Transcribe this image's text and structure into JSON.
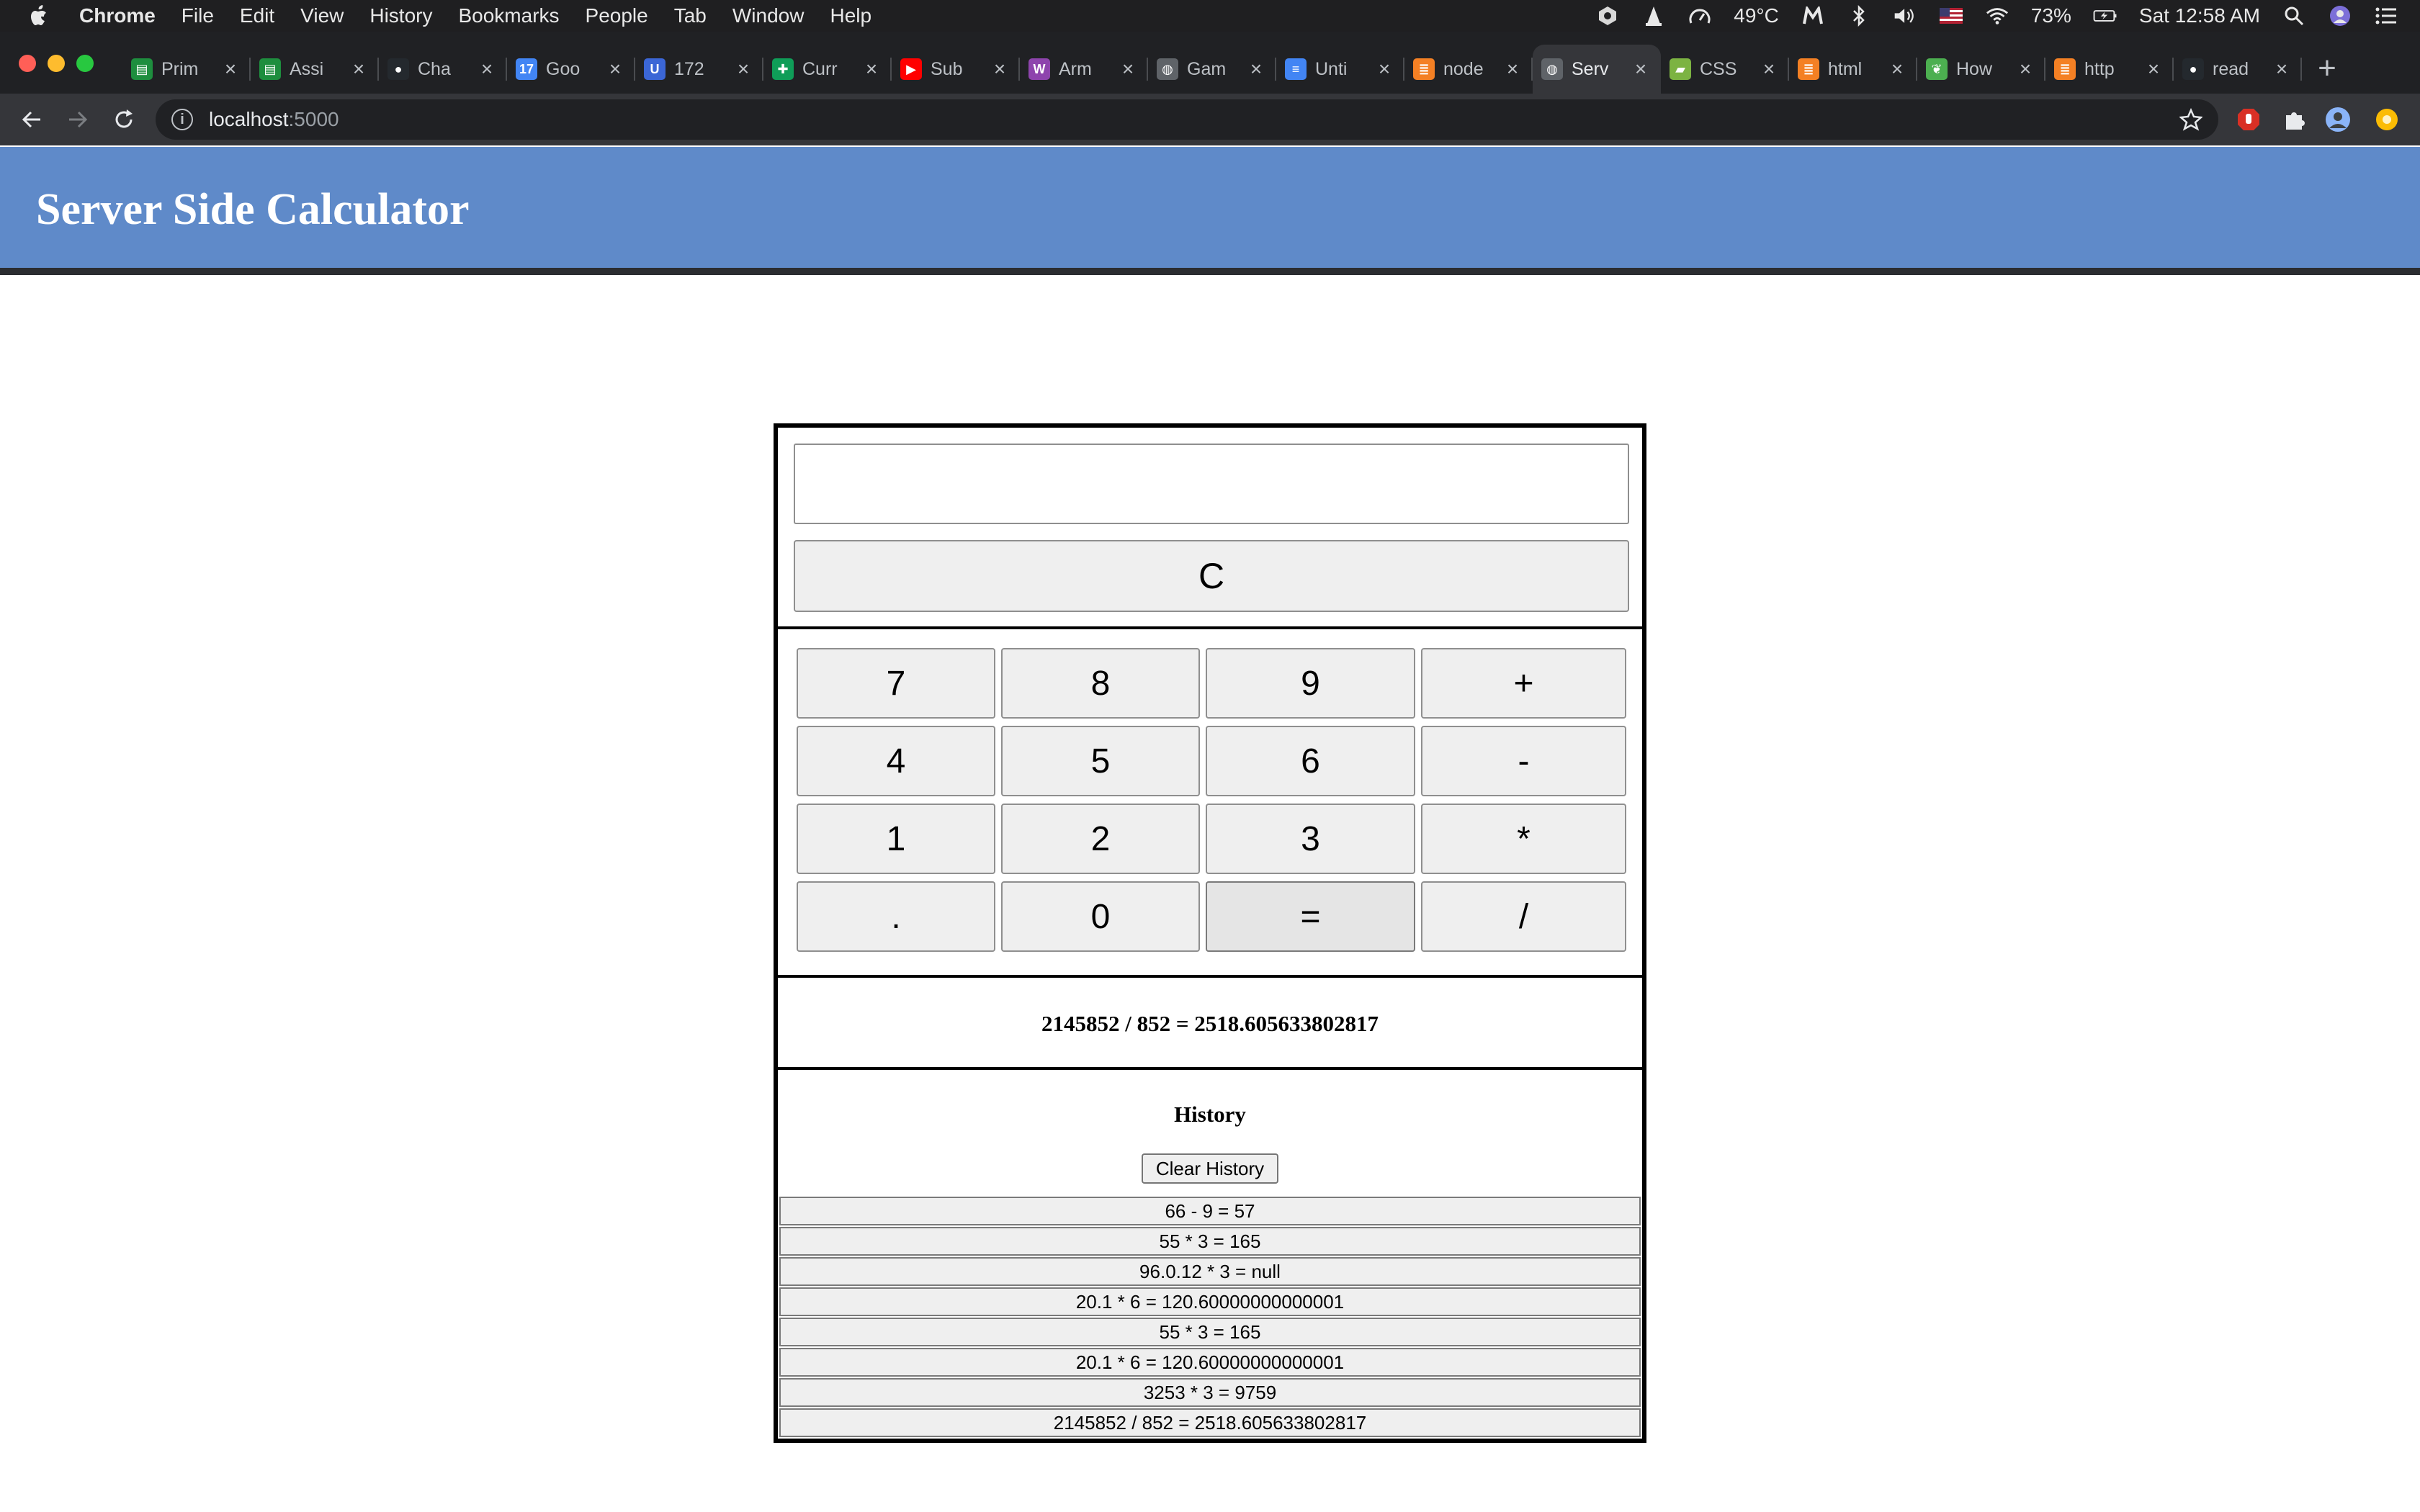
{
  "menubar": {
    "app_name": "Chrome",
    "items": [
      "File",
      "Edit",
      "View",
      "History",
      "Bookmarks",
      "People",
      "Tab",
      "Window",
      "Help"
    ],
    "status": {
      "temperature": "49°C",
      "battery": "73%",
      "clock": "Sat 12:58 AM"
    }
  },
  "browser": {
    "tabs": [
      {
        "label": "Prim",
        "icon": "sheet-icon",
        "color": "#1e8e3e"
      },
      {
        "label": "Assi",
        "icon": "sheet-icon",
        "color": "#1e8e3e"
      },
      {
        "label": "Cha",
        "icon": "github-icon",
        "color": "#24292e"
      },
      {
        "label": "Goo",
        "icon": "calendar-icon",
        "color": "#4285f4"
      },
      {
        "label": "172",
        "icon": "u-icon",
        "color": "#3b66d6"
      },
      {
        "label": "Curr",
        "icon": "sheets-icon",
        "color": "#0f9d58"
      },
      {
        "label": "Sub",
        "icon": "youtube-icon",
        "color": "#ff0000"
      },
      {
        "label": "Arm",
        "icon": "w-icon",
        "color": "#8e44ad"
      },
      {
        "label": "Gam",
        "icon": "globe-icon",
        "color": "#5f6368"
      },
      {
        "label": "Unti",
        "icon": "docs-icon",
        "color": "#4285f4"
      },
      {
        "label": "node",
        "icon": "stackoverflow-icon",
        "color": "#f48024"
      },
      {
        "label": "Serv",
        "icon": "globe-icon",
        "color": "#5f6368",
        "active": true
      },
      {
        "label": "CSS",
        "icon": "css-icon",
        "color": "#7cb342"
      },
      {
        "label": "html",
        "icon": "stackoverflow-icon",
        "color": "#f48024"
      },
      {
        "label": "How",
        "icon": "leaf-icon",
        "color": "#4caf50"
      },
      {
        "label": "http",
        "icon": "stackoverflow-icon",
        "color": "#f48024"
      },
      {
        "label": "read",
        "icon": "github-icon",
        "color": "#24292e"
      }
    ],
    "address": {
      "host": "localhost",
      "port": ":5000"
    }
  },
  "app": {
    "title": "Server Side Calculator",
    "display_value": "",
    "clear_label": "C",
    "keys": [
      [
        "7",
        "8",
        "9",
        "+"
      ],
      [
        "4",
        "5",
        "6",
        "-"
      ],
      [
        "1",
        "2",
        "3",
        "*"
      ],
      [
        ".",
        "0",
        "=",
        "/"
      ]
    ],
    "result": "2145852 / 852 = 2518.605633802817",
    "history_title": "History",
    "clear_history_label": "Clear History",
    "history": [
      "66 - 9 = 57",
      "55 * 3 = 165",
      "96.0.12 * 3 = null",
      "20.1 * 6 = 120.60000000000001",
      "55 * 3 = 165",
      "20.1 * 6 = 120.60000000000001",
      "3253 * 3 = 9759",
      "2145852 / 852 = 2518.605633802817"
    ]
  },
  "colors": {
    "header_bg": "#5f8ac9",
    "button_bg": "#efefef"
  }
}
